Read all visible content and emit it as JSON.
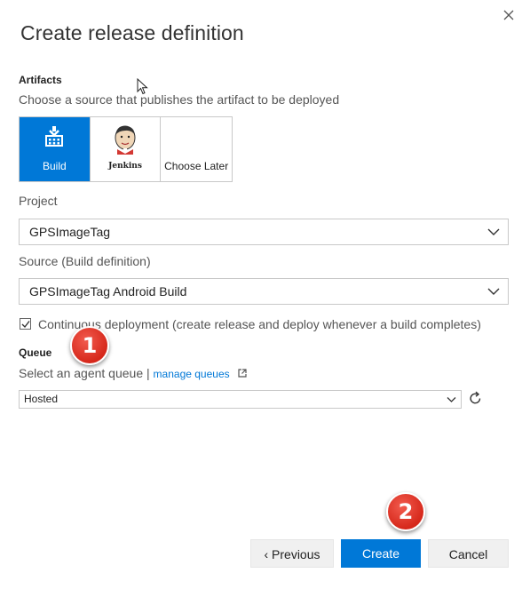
{
  "dialog": {
    "title": "Create release definition",
    "close_icon": "close-icon"
  },
  "artifacts": {
    "heading": "Artifacts",
    "help": "Choose a source that publishes the artifact to be deployed",
    "tiles": [
      {
        "label": "Build",
        "icon": "build-icon",
        "selected": true
      },
      {
        "label": "Jenkins",
        "icon": "jenkins-logo",
        "selected": false
      },
      {
        "label": "Choose Later",
        "icon": "",
        "selected": false
      }
    ]
  },
  "project": {
    "label": "Project",
    "value": "GPSImageTag"
  },
  "source": {
    "label": "Source (Build definition)",
    "value": "GPSImageTag Android Build"
  },
  "continuous_deployment": {
    "checked": true,
    "label": "Continuous deployment (create release and deploy whenever a build completes)"
  },
  "queue": {
    "heading": "Queue",
    "help": "Select an agent queue |",
    "manage_link": "manage queues",
    "value": "Hosted"
  },
  "buttons": {
    "previous": "‹ Previous",
    "create": "Create",
    "cancel": "Cancel"
  },
  "annotations": {
    "badge1": "1",
    "badge2": "2",
    "badge_color": "#d6281b"
  },
  "colors": {
    "accent": "#0078d7"
  }
}
